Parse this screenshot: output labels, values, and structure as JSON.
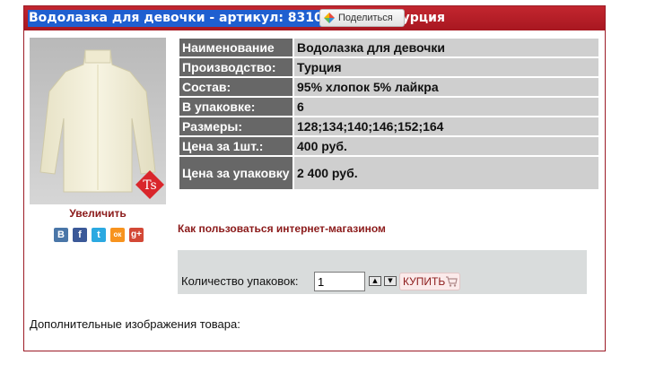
{
  "header": {
    "title_left": "Водолазка для девочки - артикул: 8310016",
    "title_right": "тво: Турция",
    "share_label": "Поделиться"
  },
  "product": {
    "zoom_label": "Увеличить",
    "logo_text": "Ts",
    "socials": [
      {
        "name": "vkontakte",
        "glyph": "B",
        "color": "#4a76a8"
      },
      {
        "name": "facebook",
        "glyph": "f",
        "color": "#3b5998"
      },
      {
        "name": "twitter",
        "glyph": "t",
        "color": "#2ba9e1"
      },
      {
        "name": "odnoklassniki",
        "glyph": "ок",
        "color": "#f7931e"
      },
      {
        "name": "google-plus",
        "glyph": "g+",
        "color": "#d34836"
      }
    ]
  },
  "props": [
    {
      "k": "Наименование",
      "v": "Водолазка для девочки"
    },
    {
      "k": "Производство:",
      "v": "Турция"
    },
    {
      "k": "Состав:",
      "v": "95% хлопок 5% лайкра"
    },
    {
      "k": "В упаковке:",
      "v": "6"
    },
    {
      "k": "Размеры:",
      "v": "128;134;140;146;152;164"
    },
    {
      "k": "Цена за 1шт.:",
      "v": "400 руб."
    },
    {
      "k": "Цена за упаковку",
      "v": "2 400 руб."
    }
  ],
  "howto_link": "Как пользоваться интернет-магазином",
  "order": {
    "qty_label": "Количество упаковок:",
    "qty_value": "1",
    "buy_label": "КУПИТЬ"
  },
  "more_images_label": "Дополнительные изображения товара:"
}
